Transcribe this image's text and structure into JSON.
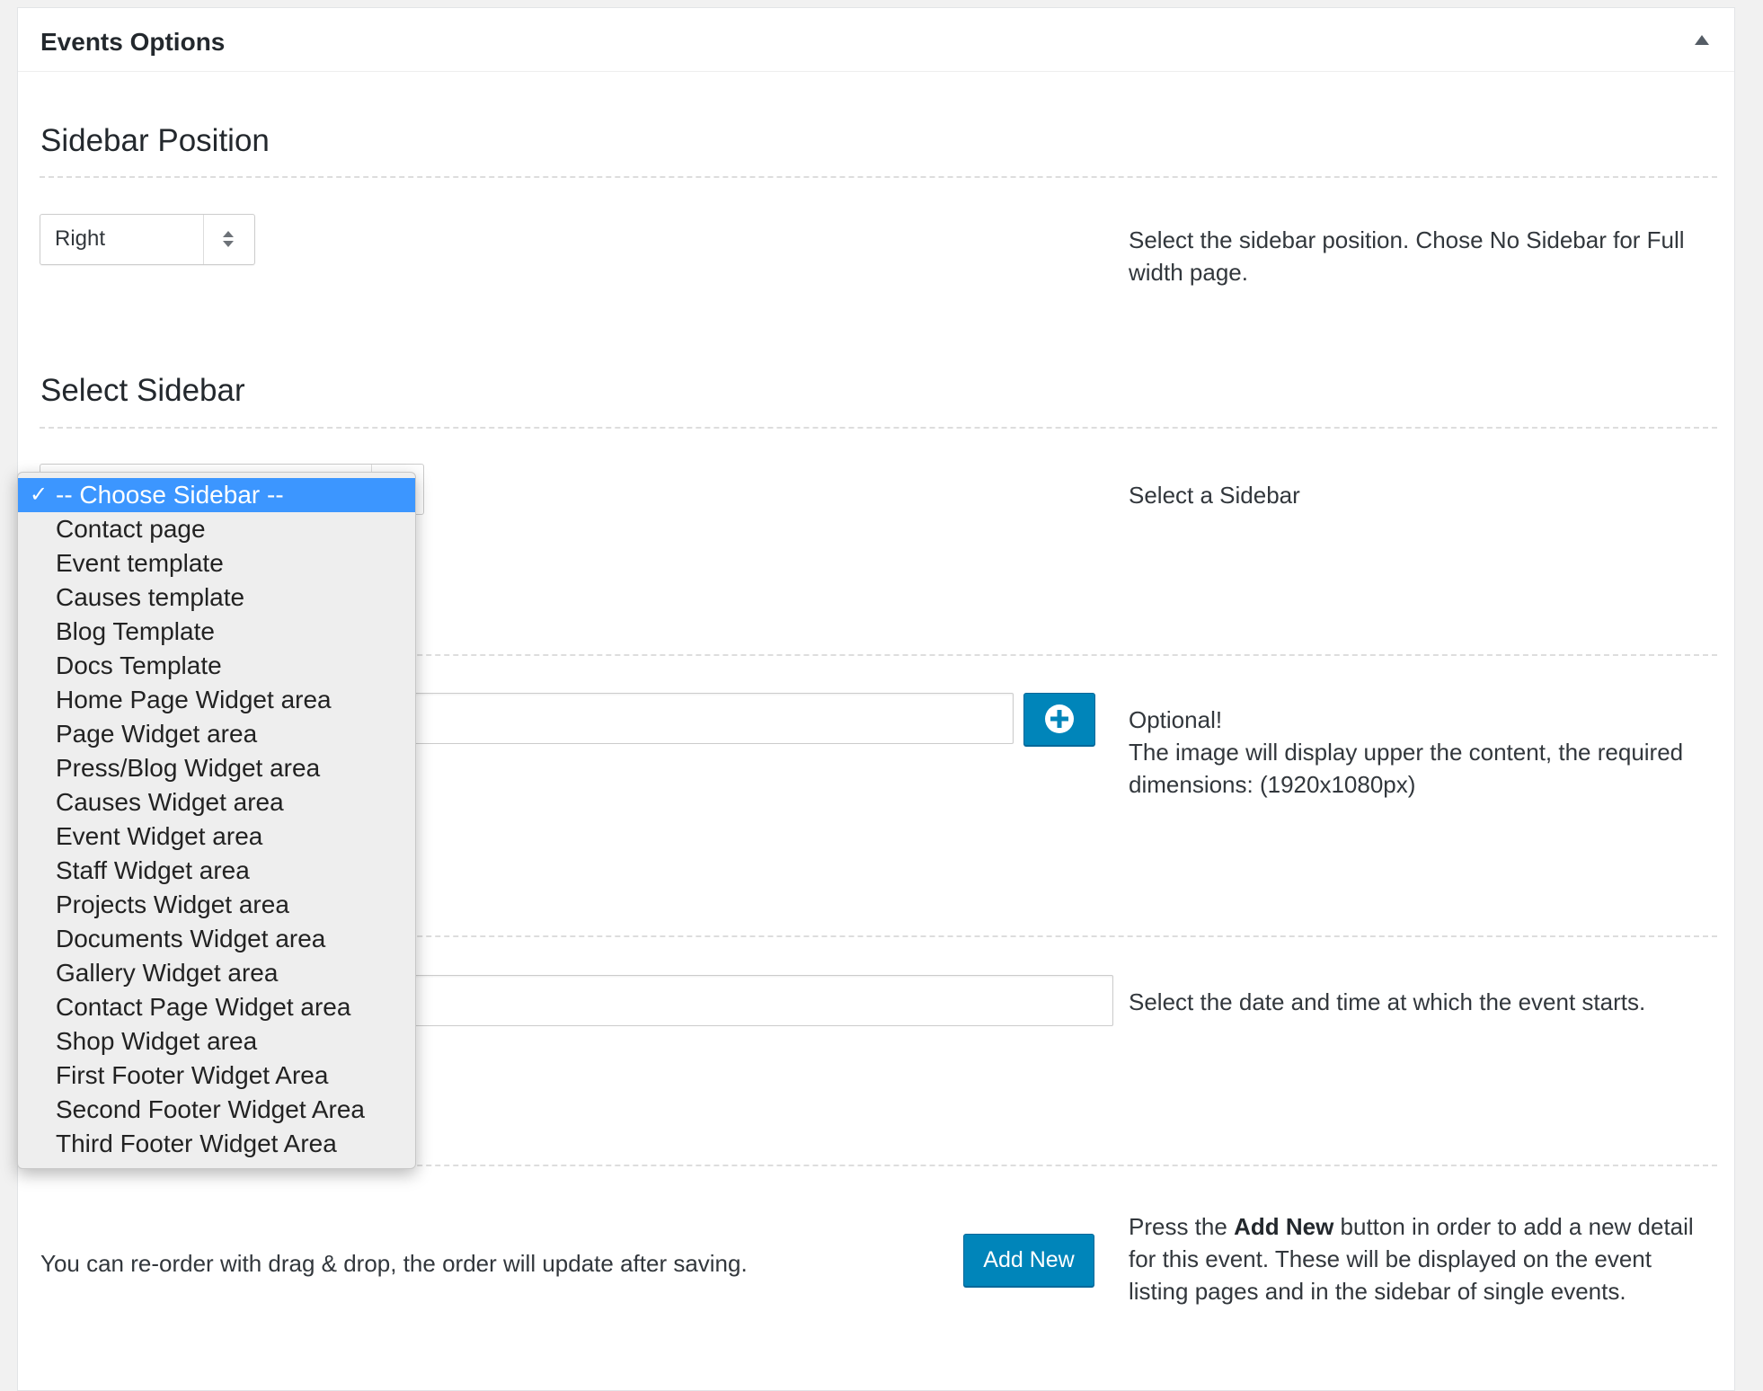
{
  "panel": {
    "title": "Events Options"
  },
  "sidebar_position": {
    "heading": "Sidebar Position",
    "selected": "Right",
    "description": "Select the sidebar position. Chose No Sidebar for Full width page."
  },
  "select_sidebar": {
    "heading": "Select Sidebar",
    "description": "Select a Sidebar",
    "options": [
      "-- Choose Sidebar --",
      "Contact page",
      "Event template",
      "Causes template",
      "Blog Template",
      "Docs Template",
      "Home Page Widget area",
      "Page Widget area",
      "Press/Blog Widget area",
      "Causes Widget area",
      "Event Widget area",
      "Staff Widget area",
      "Projects Widget area",
      "Documents Widget area",
      "Gallery Widget area",
      "Contact Page Widget area",
      "Shop Widget area",
      "First Footer Widget Area",
      "Second Footer Widget Area",
      "Third Footer Widget Area"
    ],
    "selected_index": 0
  },
  "image_field": {
    "value": "",
    "description_line1": "Optional!",
    "description_line2": "The image will display upper the content, the required dimensions: (1920x1080px)"
  },
  "date_field": {
    "value": "",
    "description": "Select the date and time at which the event starts."
  },
  "details": {
    "reorder_text": "You can re-order with drag & drop, the order will update after saving.",
    "add_new_label": "Add New",
    "desc_prefix": "Press the ",
    "desc_bold": "Add New",
    "desc_suffix": " button in order to add a new detail for this event. These will be displayed on the event listing pages and in the sidebar of single events."
  },
  "colors": {
    "primary_button": "#0085ba",
    "dropdown_highlight": "#3c96ff"
  }
}
